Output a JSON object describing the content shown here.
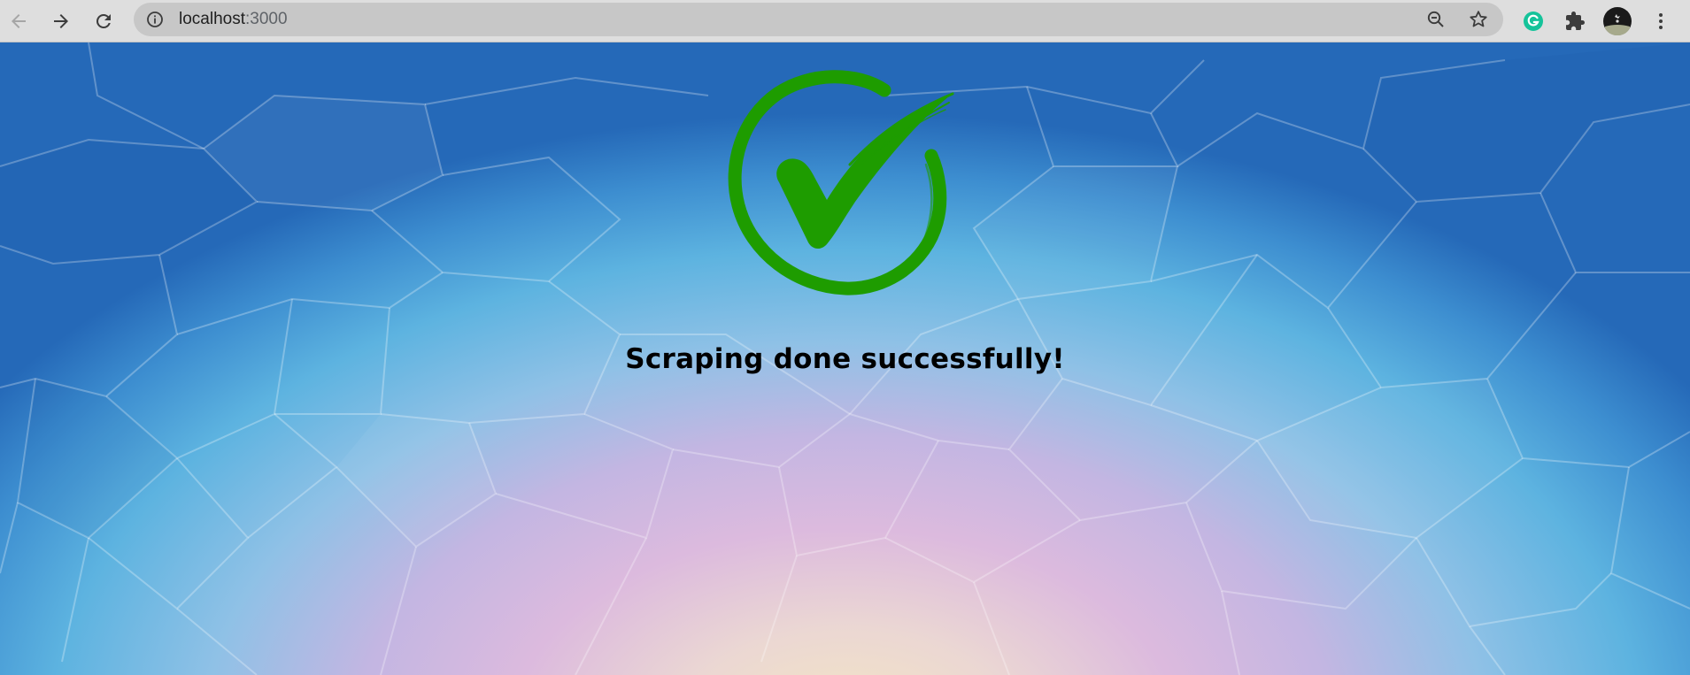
{
  "browser": {
    "back_icon": "arrow-left-icon",
    "forward_icon": "arrow-right-icon",
    "reload_icon": "reload-icon",
    "address_bar": {
      "info_icon": "info-circle-icon",
      "host": "localhost",
      "port": ":3000"
    },
    "zoom_icon": "zoom-out-icon",
    "bookmark_icon": "star-icon",
    "extensions": [
      {
        "icon": "grammarly-icon",
        "color": "#15c39a"
      },
      {
        "icon": "puzzle-piece-icon"
      }
    ],
    "profile_icon": "avatar-icon",
    "menu_icon": "kebab-menu-icon"
  },
  "page": {
    "success_icon": "check-circle-icon",
    "check_color": "#1e9c00",
    "message": "Scraping done successfully!"
  }
}
